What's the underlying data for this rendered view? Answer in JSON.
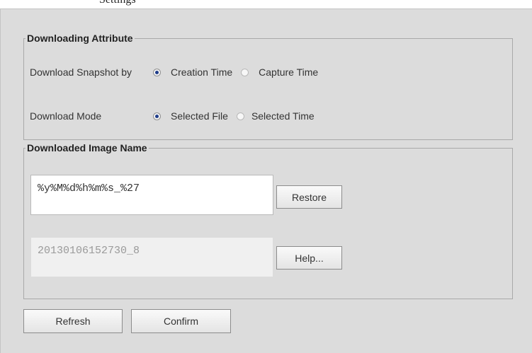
{
  "top_text": "Settings",
  "downloading_attribute": {
    "legend": "Downloading Attribute",
    "snapshot": {
      "label": "Download Snapshot by",
      "options": [
        "Creation Time",
        "Capture Time"
      ],
      "selected": "Creation Time"
    },
    "mode": {
      "label": "Download Mode",
      "options": [
        "Selected File",
        "Selected Time"
      ],
      "selected": "Selected File"
    }
  },
  "downloaded_image_name": {
    "legend": "Downloaded Image Name",
    "pattern_value": "%y%M%d%h%m%s_%27",
    "preview_value": "20130106152730_8",
    "restore_label": "Restore",
    "help_label": "Help..."
  },
  "actions": {
    "refresh_label": "Refresh",
    "confirm_label": "Confirm"
  },
  "colors": {
    "panel_bg": "#dcdcdc",
    "radio_dot": "#1f3d8a"
  }
}
